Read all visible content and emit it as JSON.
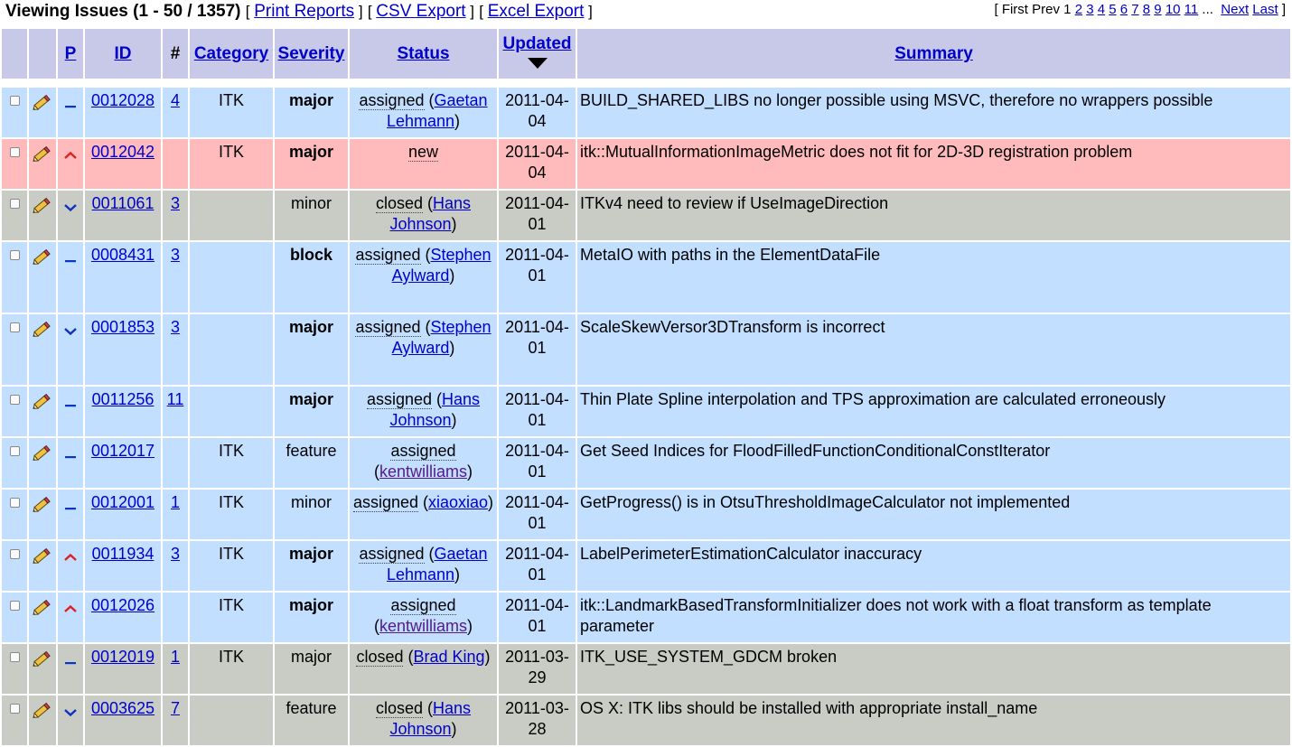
{
  "header": {
    "title": "Viewing Issues (1 - 50 / 1357)",
    "links": [
      "Print Reports",
      "CSV Export",
      "Excel Export"
    ]
  },
  "pager": {
    "first": "First",
    "prev": "Prev",
    "current": "1",
    "pages": [
      "2",
      "3",
      "4",
      "5",
      "6",
      "7",
      "8",
      "9",
      "10",
      "11"
    ],
    "ellipsis": "...",
    "next": "Next",
    "last": "Last"
  },
  "columns": {
    "p": "P",
    "id": "ID",
    "notes": "#",
    "category": "Category",
    "severity": "Severity",
    "status": "Status",
    "updated": "Updated",
    "summary": "Summary"
  },
  "colors": {
    "assigned": "#c2dfff",
    "new": "#ffbbbb",
    "closed": "#c9ccc4",
    "header": "#c8c8e8"
  },
  "rows": [
    {
      "id": "0012028",
      "notes": "4",
      "category": "ITK",
      "severity": "major",
      "sev_bold": true,
      "status": "assigned",
      "handler": "Gaetan Lehmann",
      "updated": "2011-04-04",
      "summary": "BUILD_SHARED_LIBS no longer possible using MSVC, therefore no wrappers possible",
      "priority": "normal",
      "state": "assigned"
    },
    {
      "id": "0012042",
      "notes": "",
      "category": "ITK",
      "severity": "major",
      "sev_bold": true,
      "status": "new",
      "handler": "",
      "updated": "2011-04-04",
      "summary": "itk::MutualInformationImageMetric does not fit for 2D-3D registration problem",
      "priority": "high",
      "state": "new"
    },
    {
      "id": "0011061",
      "notes": "3",
      "category": "",
      "severity": "minor",
      "sev_bold": false,
      "status": "closed",
      "handler": "Hans Johnson",
      "updated": "2011-04-01",
      "summary": "ITKv4 need to review if UseImageDirection",
      "priority": "low",
      "state": "closed"
    },
    {
      "id": "0008431",
      "notes": "3",
      "category": "",
      "severity": "block",
      "sev_bold": true,
      "status": "assigned",
      "handler": "Stephen Aylward",
      "updated": "2011-04-01",
      "summary": "MetaIO with paths in the ElementDataFile",
      "priority": "normal",
      "state": "assigned"
    },
    {
      "id": "0001853",
      "notes": "3",
      "category": "",
      "severity": "major",
      "sev_bold": true,
      "status": "assigned",
      "handler": "Stephen Aylward",
      "updated": "2011-04-01",
      "summary": "ScaleSkewVersor3DTransform is incorrect",
      "priority": "low",
      "state": "assigned"
    },
    {
      "id": "0011256",
      "notes": "11",
      "category": "",
      "severity": "major",
      "sev_bold": true,
      "status": "assigned",
      "handler": "Hans Johnson",
      "updated": "2011-04-01",
      "summary": "Thin Plate Spline interpolation and TPS approximation are calculated erroneously",
      "priority": "normal",
      "state": "assigned"
    },
    {
      "id": "0012017",
      "notes": "",
      "category": "ITK",
      "severity": "feature",
      "sev_bold": false,
      "status": "assigned",
      "handler": "kentwilliams",
      "updated": "2011-04-01",
      "summary": "Get Seed Indices for FloodFilledFunctionConditionalConstIterator",
      "priority": "normal",
      "state": "assigned"
    },
    {
      "id": "0012001",
      "notes": "1",
      "category": "ITK",
      "severity": "minor",
      "sev_bold": false,
      "status": "assigned",
      "handler": "xiaoxiao",
      "updated": "2011-04-01",
      "summary": "GetProgress() is in OtsuThresholdImageCalculator not implemented",
      "priority": "normal",
      "state": "assigned"
    },
    {
      "id": "0011934",
      "notes": "3",
      "category": "ITK",
      "severity": "major",
      "sev_bold": true,
      "status": "assigned",
      "handler": "Gaetan Lehmann",
      "updated": "2011-04-01",
      "summary": "LabelPerimeterEstimationCalculator inaccuracy",
      "priority": "high",
      "state": "assigned"
    },
    {
      "id": "0012026",
      "notes": "",
      "category": "ITK",
      "severity": "major",
      "sev_bold": true,
      "status": "assigned",
      "handler": "kentwilliams",
      "updated": "2011-04-01",
      "summary": "itk::LandmarkBasedTransformInitializer does not work with a float transform as template parameter",
      "priority": "high",
      "state": "assigned"
    },
    {
      "id": "0012019",
      "notes": "1",
      "category": "ITK",
      "severity": "major",
      "sev_bold": false,
      "status": "closed",
      "handler": "Brad King",
      "updated": "2011-03-29",
      "summary": "ITK_USE_SYSTEM_GDCM broken",
      "priority": "normal",
      "state": "closed"
    },
    {
      "id": "0003625",
      "notes": "7",
      "category": "",
      "severity": "feature",
      "sev_bold": false,
      "status": "closed",
      "handler": "Hans Johnson",
      "updated": "2011-03-28",
      "summary": "OS X: ITK libs should be installed with appropriate install_name",
      "priority": "low",
      "state": "closed"
    }
  ]
}
